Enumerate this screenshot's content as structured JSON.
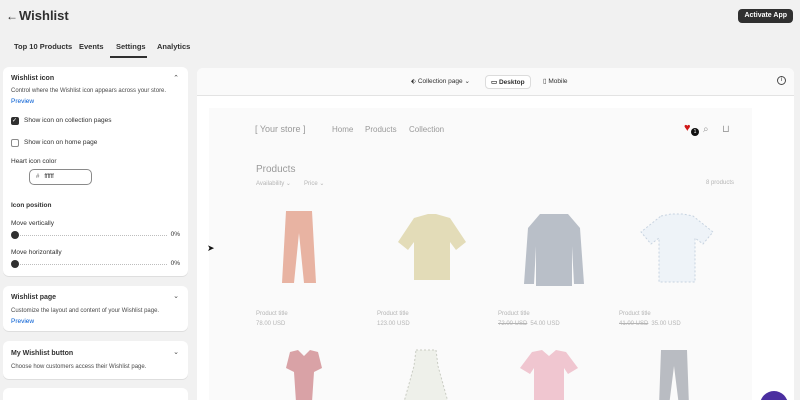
{
  "header": {
    "back_icon": "arrow-left-icon",
    "title": "Wishlist",
    "activate_label": "Activate App"
  },
  "tabs": [
    {
      "label": "Top 10 Products"
    },
    {
      "label": "Events"
    },
    {
      "label": "Settings",
      "active": true
    },
    {
      "label": "Analytics"
    }
  ],
  "wishlist_icon_panel": {
    "title": "Wishlist icon",
    "description": "Control where the Wishlist icon appears across your store.",
    "preview_link": "Preview",
    "show_collection_label": "Show icon on collection pages",
    "show_collection_checked": true,
    "show_home_label": "Show icon on home page",
    "show_home_checked": false,
    "heart_color_label": "Heart icon color",
    "heart_color_value": "ffffff",
    "heart_color_prefix": "#",
    "icon_position_label": "Icon position",
    "move_vertical_label": "Move vertically",
    "move_vertical_value": "0%",
    "move_horizontal_label": "Move horizontally",
    "move_horizontal_value": "0%"
  },
  "wishlist_page_panel": {
    "title": "Wishlist page",
    "description": "Customize the layout and content of your Wishlist page.",
    "preview_link": "Preview"
  },
  "my_wishlist_button_panel": {
    "title": "My Wishlist button",
    "description": "Choose how customers access their Wishlist page."
  },
  "preview_toolbar": {
    "page_select": "Collection page",
    "desktop_label": "Desktop",
    "mobile_label": "Mobile"
  },
  "store_preview": {
    "logo": "[ Your store ]",
    "nav": [
      "Home",
      "Products",
      "Collection"
    ],
    "wishlist_count": "1",
    "heading": "Products",
    "filters": [
      "Availability",
      "Price"
    ],
    "product_count": "8 products",
    "products": [
      {
        "title": "Product title",
        "price": "78.00 USD",
        "compare": ""
      },
      {
        "title": "Product title",
        "price": "123.00 USD",
        "compare": ""
      },
      {
        "title": "Product title",
        "price": "54.00 USD",
        "compare": "72.00 USD"
      },
      {
        "title": "Product title",
        "price": "35.00 USD",
        "compare": "41.00 USD"
      }
    ]
  },
  "colors": {
    "accent": "#303030",
    "link": "#005bd3",
    "heart": "#d01818",
    "fab": "#4b2fa0"
  }
}
